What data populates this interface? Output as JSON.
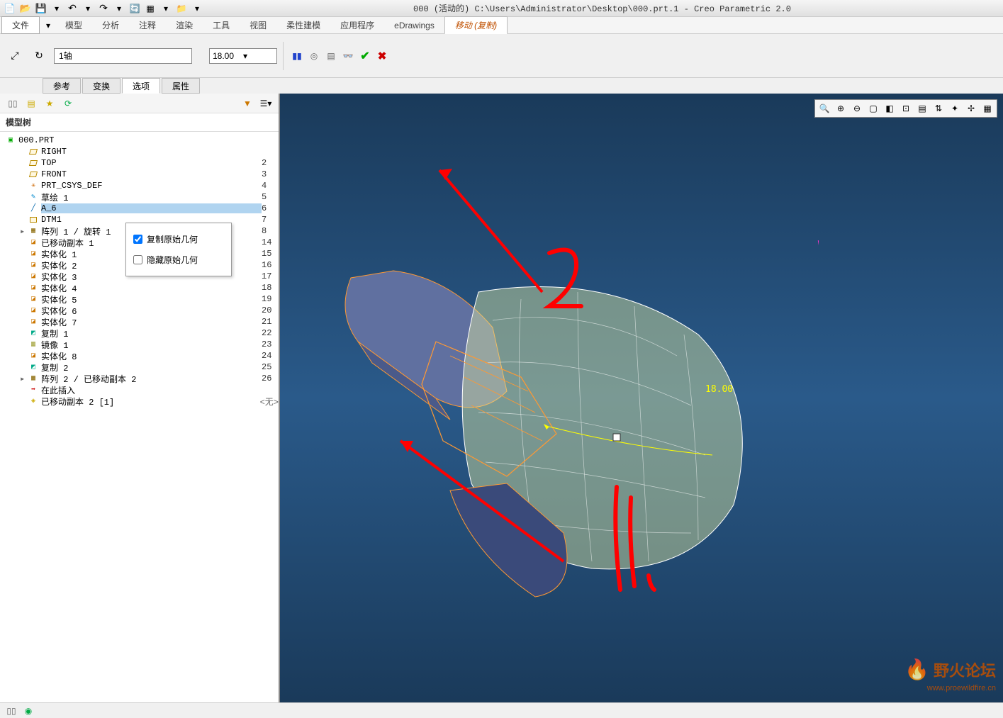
{
  "title": "000 (活动的) C:\\Users\\Administrator\\Desktop\\000.prt.1 - Creo Parametric 2.0",
  "menu": {
    "file": "文件",
    "items": [
      "模型",
      "分析",
      "注释",
      "渲染",
      "工具",
      "视图",
      "柔性建模",
      "应用程序",
      "eDrawings"
    ],
    "active": "移动 (复制)"
  },
  "ribbon": {
    "axis_input": "1轴",
    "value_input": "18.00"
  },
  "subtabs": {
    "items": [
      "参考",
      "变换",
      "选项",
      "属性"
    ],
    "active": "选项"
  },
  "popup": {
    "copy_orig": "复制原始几何",
    "hide_orig": "隐藏原始几何",
    "copy_checked": true,
    "hide_checked": false
  },
  "side": {
    "title": "模型树"
  },
  "tree": {
    "root": "000.PRT",
    "items": [
      {
        "label": "RIGHT",
        "icon": "plane",
        "num": ""
      },
      {
        "label": "TOP",
        "icon": "plane",
        "num": "2"
      },
      {
        "label": "FRONT",
        "icon": "plane",
        "num": "3"
      },
      {
        "label": "PRT_CSYS_DEF",
        "icon": "csys",
        "num": "4"
      },
      {
        "label": "草绘 1",
        "icon": "sketch",
        "num": "5"
      },
      {
        "label": "A_6",
        "icon": "axis",
        "num": "6",
        "hl": true
      },
      {
        "label": "DTM1",
        "icon": "dtm",
        "num": "7"
      },
      {
        "label": "阵列 1 / 旋转 1",
        "icon": "feat",
        "num": "8",
        "expand": true
      },
      {
        "label": "已移动副本 1",
        "icon": "body",
        "num": "14"
      },
      {
        "label": "实体化 1",
        "icon": "body",
        "num": "15"
      },
      {
        "label": "实体化 2",
        "icon": "body",
        "num": "16"
      },
      {
        "label": "实体化 3",
        "icon": "body",
        "num": "17"
      },
      {
        "label": "实体化 4",
        "icon": "body",
        "num": "18"
      },
      {
        "label": "实体化 5",
        "icon": "body",
        "num": "19"
      },
      {
        "label": "实体化 6",
        "icon": "body",
        "num": "20"
      },
      {
        "label": "实体化 7",
        "icon": "body",
        "num": "21"
      },
      {
        "label": "复制 1",
        "icon": "copy",
        "num": "22"
      },
      {
        "label": "镜像 1",
        "icon": "mirror",
        "num": "23"
      },
      {
        "label": "实体化 8",
        "icon": "body",
        "num": "24"
      },
      {
        "label": "复制 2",
        "icon": "copy",
        "num": "25"
      },
      {
        "label": "阵列 2 / 已移动副本 2",
        "icon": "feat",
        "num": "26",
        "expand": true
      },
      {
        "label": "在此插入",
        "icon": "insert",
        "num": ""
      },
      {
        "label": "已移动副本 2 [1]",
        "icon": "current",
        "num": "",
        "suffix": "<无>"
      }
    ]
  },
  "viewport": {
    "dimension": "18.00"
  },
  "watermark": {
    "text": "野火论坛",
    "url": "www.proewildfire.cn"
  }
}
